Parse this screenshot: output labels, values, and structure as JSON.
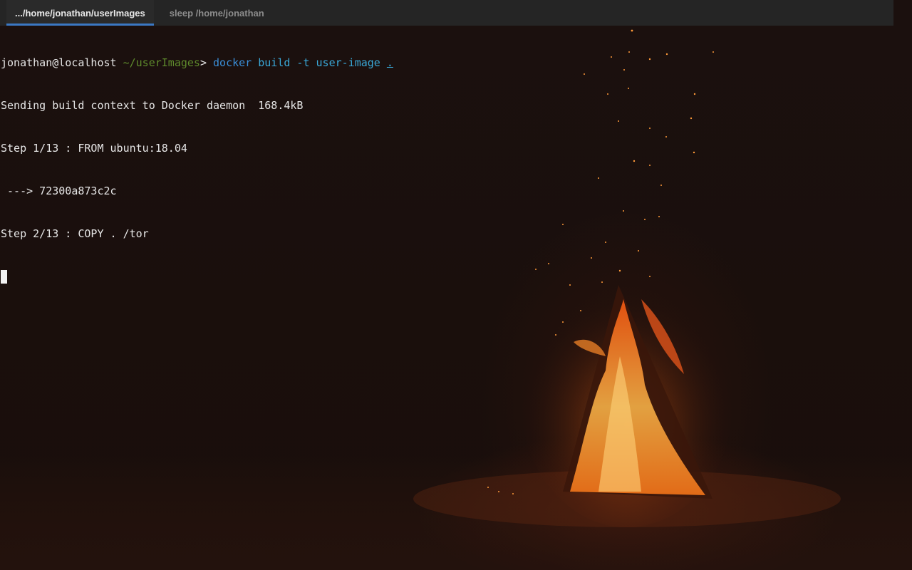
{
  "tabs": [
    {
      "label": ".../home/jonathan/userImages",
      "active": true
    },
    {
      "label": "sleep /home/jonathan",
      "active": false
    }
  ],
  "terminal": {
    "prompt": {
      "user_host": "jonathan@localhost",
      "path": "~/userImages",
      "symbol": ">",
      "command": "docker",
      "args": "build -t user-image",
      "context": "."
    },
    "output": [
      "Sending build context to Docker daemon  168.4kB",
      "Step 1/13 : FROM ubuntu:18.04",
      " ---> 72300a873c2c",
      "Step 2/13 : COPY . /tor"
    ]
  },
  "colors": {
    "tabbar_bg": "#252525",
    "active_tab_indicator": "#3b78c4",
    "prompt_path": "#5e8a2c",
    "command": "#3a8ed8",
    "background": "#1a0f0c"
  }
}
